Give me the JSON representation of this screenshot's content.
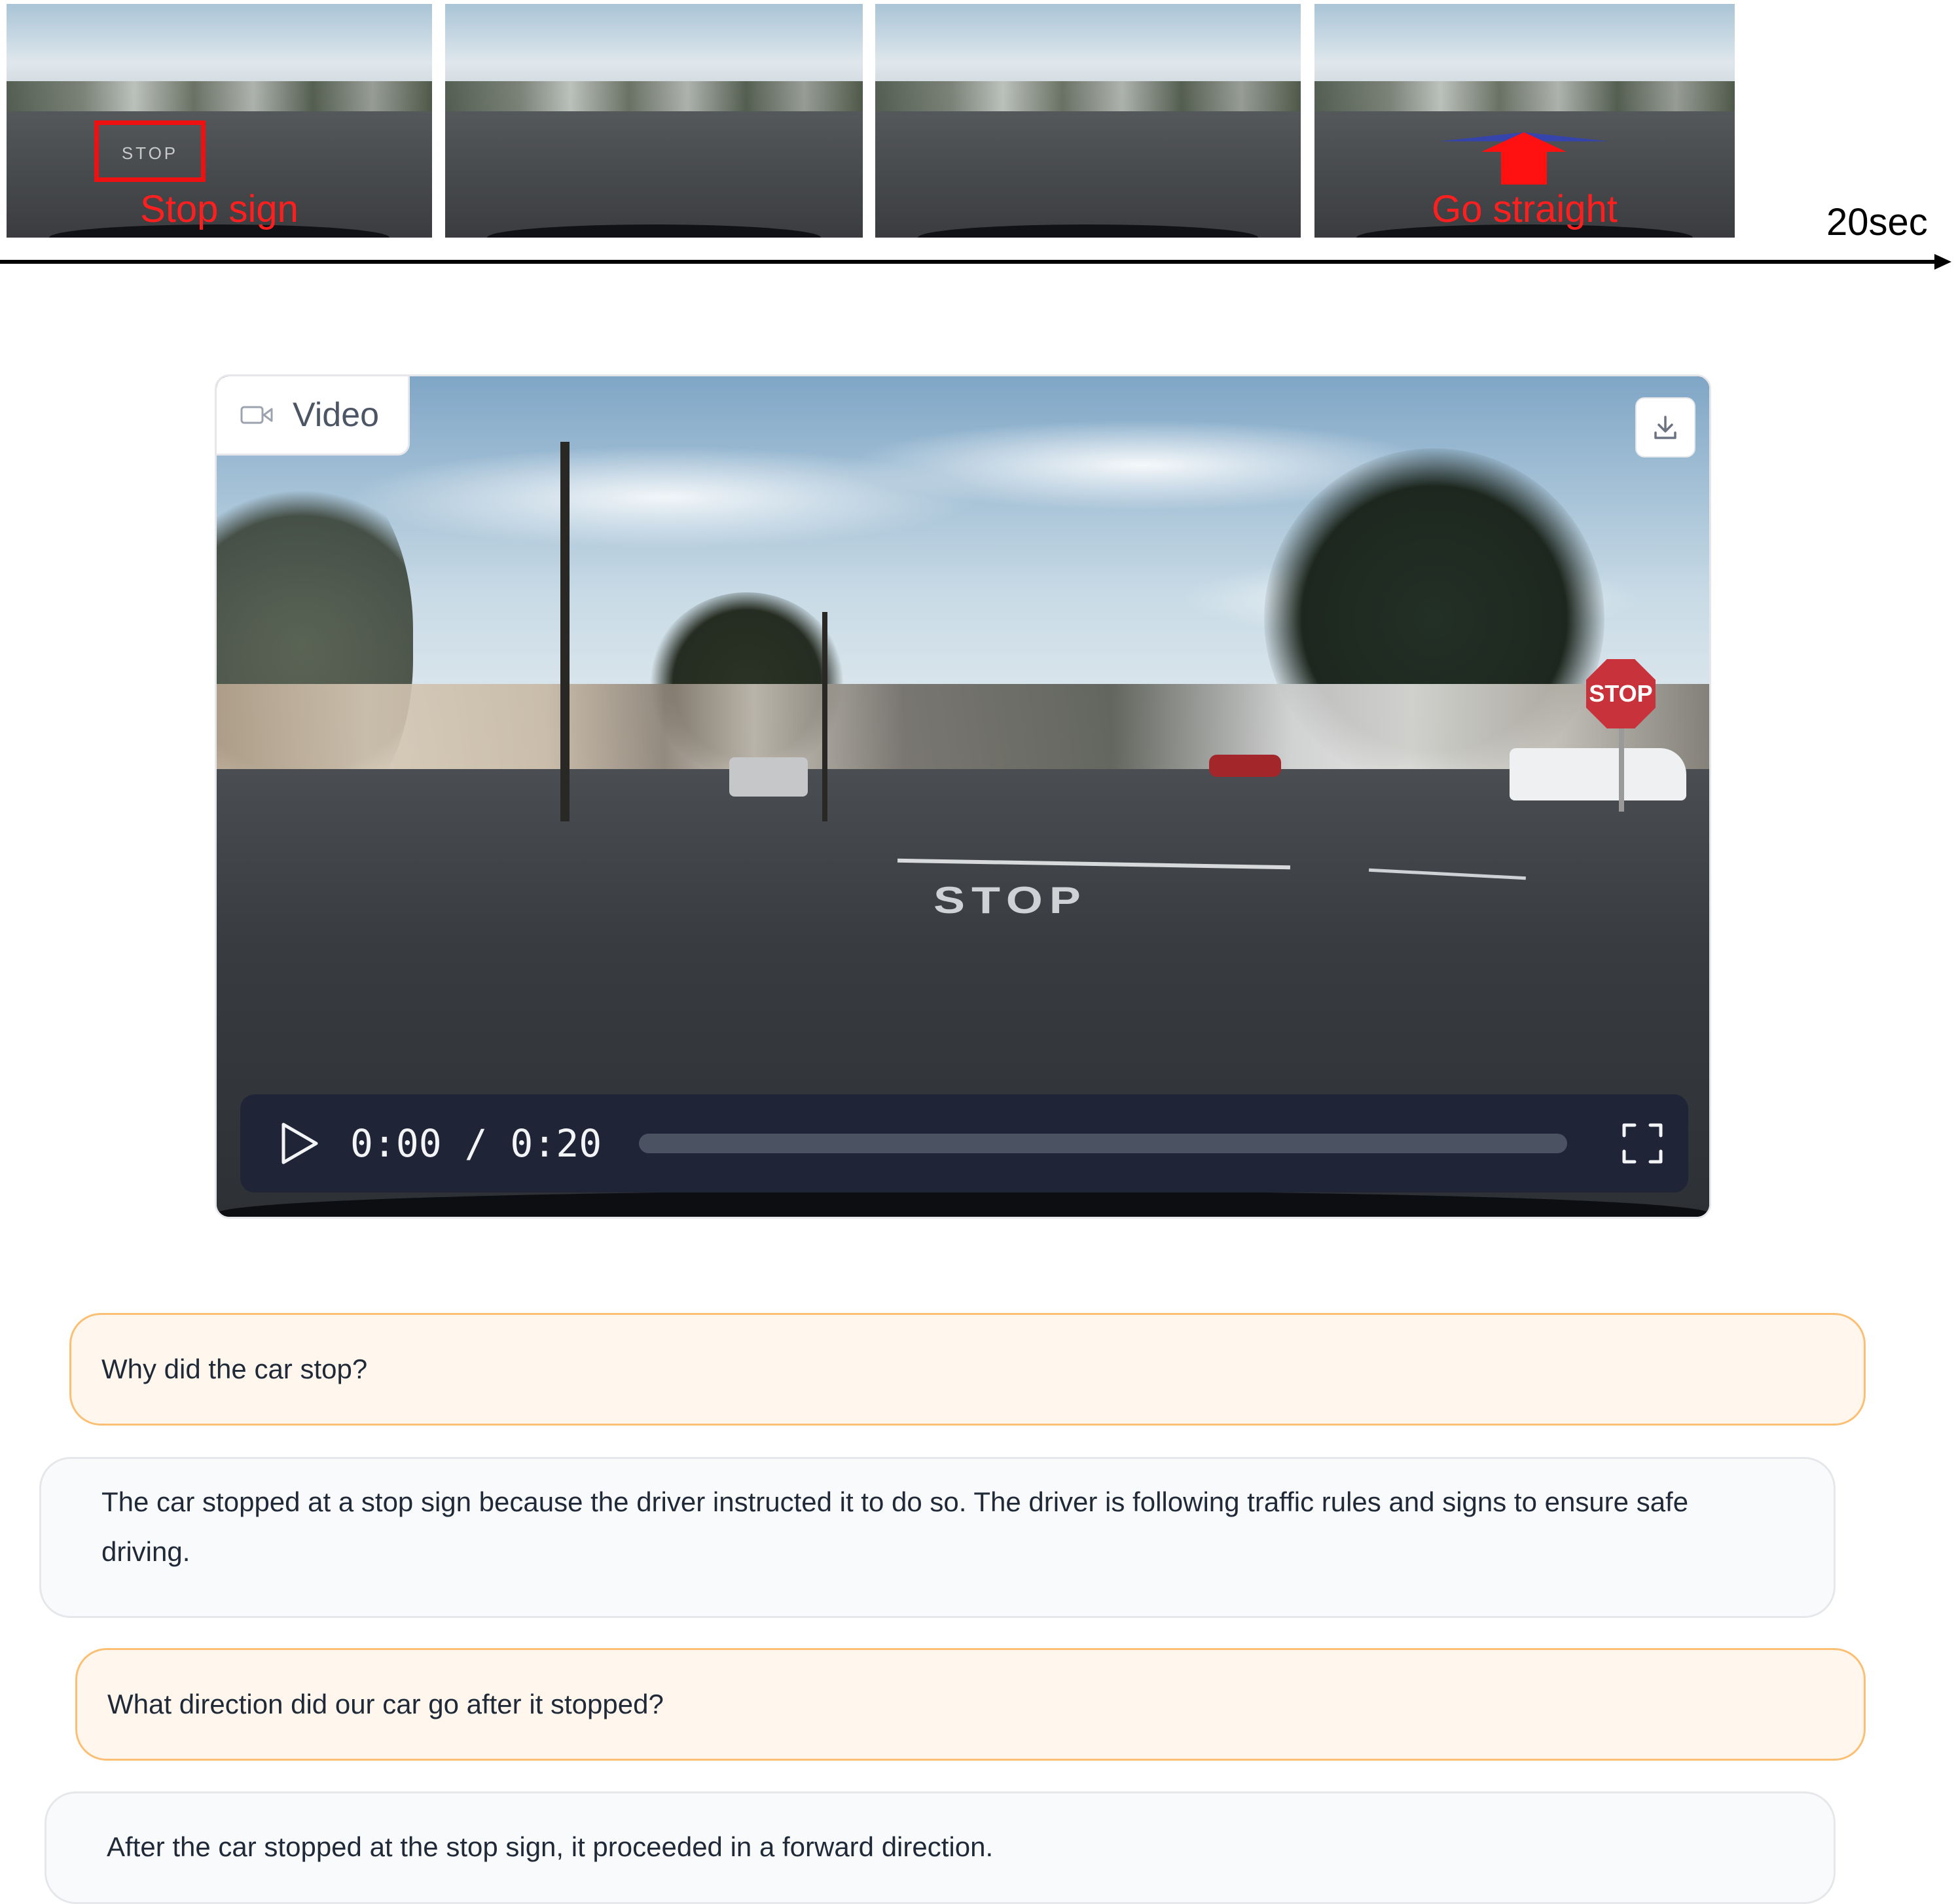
{
  "timeline": {
    "frames": [
      {
        "id": "frame-1",
        "caption": "Stop sign",
        "marker_text": "STOP"
      },
      {
        "id": "frame-2",
        "caption": ""
      },
      {
        "id": "frame-3",
        "caption": ""
      },
      {
        "id": "frame-4",
        "caption": "Go straight"
      }
    ],
    "duration_label": "20sec"
  },
  "video": {
    "badge_label": "Video",
    "road_marking": "STOP",
    "street_sign": "STOP",
    "time_display": "0:00 / 0:20",
    "progress_fraction": 0,
    "icons": [
      "video-camera-icon",
      "download-icon",
      "play-icon",
      "fullscreen-icon"
    ]
  },
  "chat": {
    "messages": [
      {
        "role": "user",
        "text": "Why did the car stop?"
      },
      {
        "role": "assistant",
        "text": "The car stopped at a stop sign because the driver instructed it to do so. The driver is following traffic rules and signs to ensure safe driving."
      },
      {
        "role": "user",
        "text": "What direction did our car go after it stopped?"
      },
      {
        "role": "assistant",
        "text": "After the car stopped at the stop sign, it proceeded in a forward direction."
      }
    ]
  },
  "colors": {
    "annotation_red": "#ff1f1f",
    "user_bubble_bg": "#fff7ed",
    "user_bubble_border": "#fbbf74",
    "bot_bubble_bg": "#f9fafb",
    "controls_bg": "#1f2536"
  }
}
